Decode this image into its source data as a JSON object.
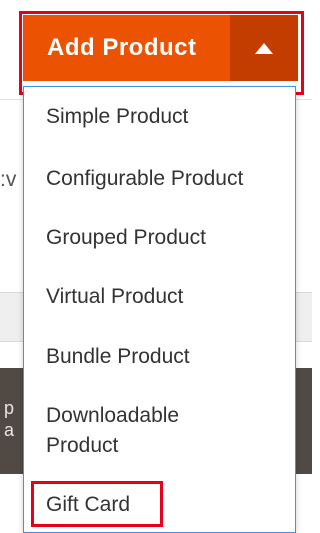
{
  "background": {
    "cut_text": ":v",
    "dark_band_lines": [
      "p",
      "a"
    ]
  },
  "add_product": {
    "label": "Add Product"
  },
  "dropdown": {
    "items": [
      {
        "label": "Simple Product"
      },
      {
        "label": "Configurable Product"
      },
      {
        "label": "Grouped Product"
      },
      {
        "label": "Virtual Product"
      },
      {
        "label": "Bundle Product"
      },
      {
        "label_line1": "Downloadable",
        "label_line2": "Product"
      },
      {
        "label": "Gift Card"
      }
    ]
  },
  "colors": {
    "primary_button": "#eb5202",
    "toggle_button": "#c33d00",
    "highlight": "#e6001a",
    "menu_border": "#4a90e2"
  }
}
